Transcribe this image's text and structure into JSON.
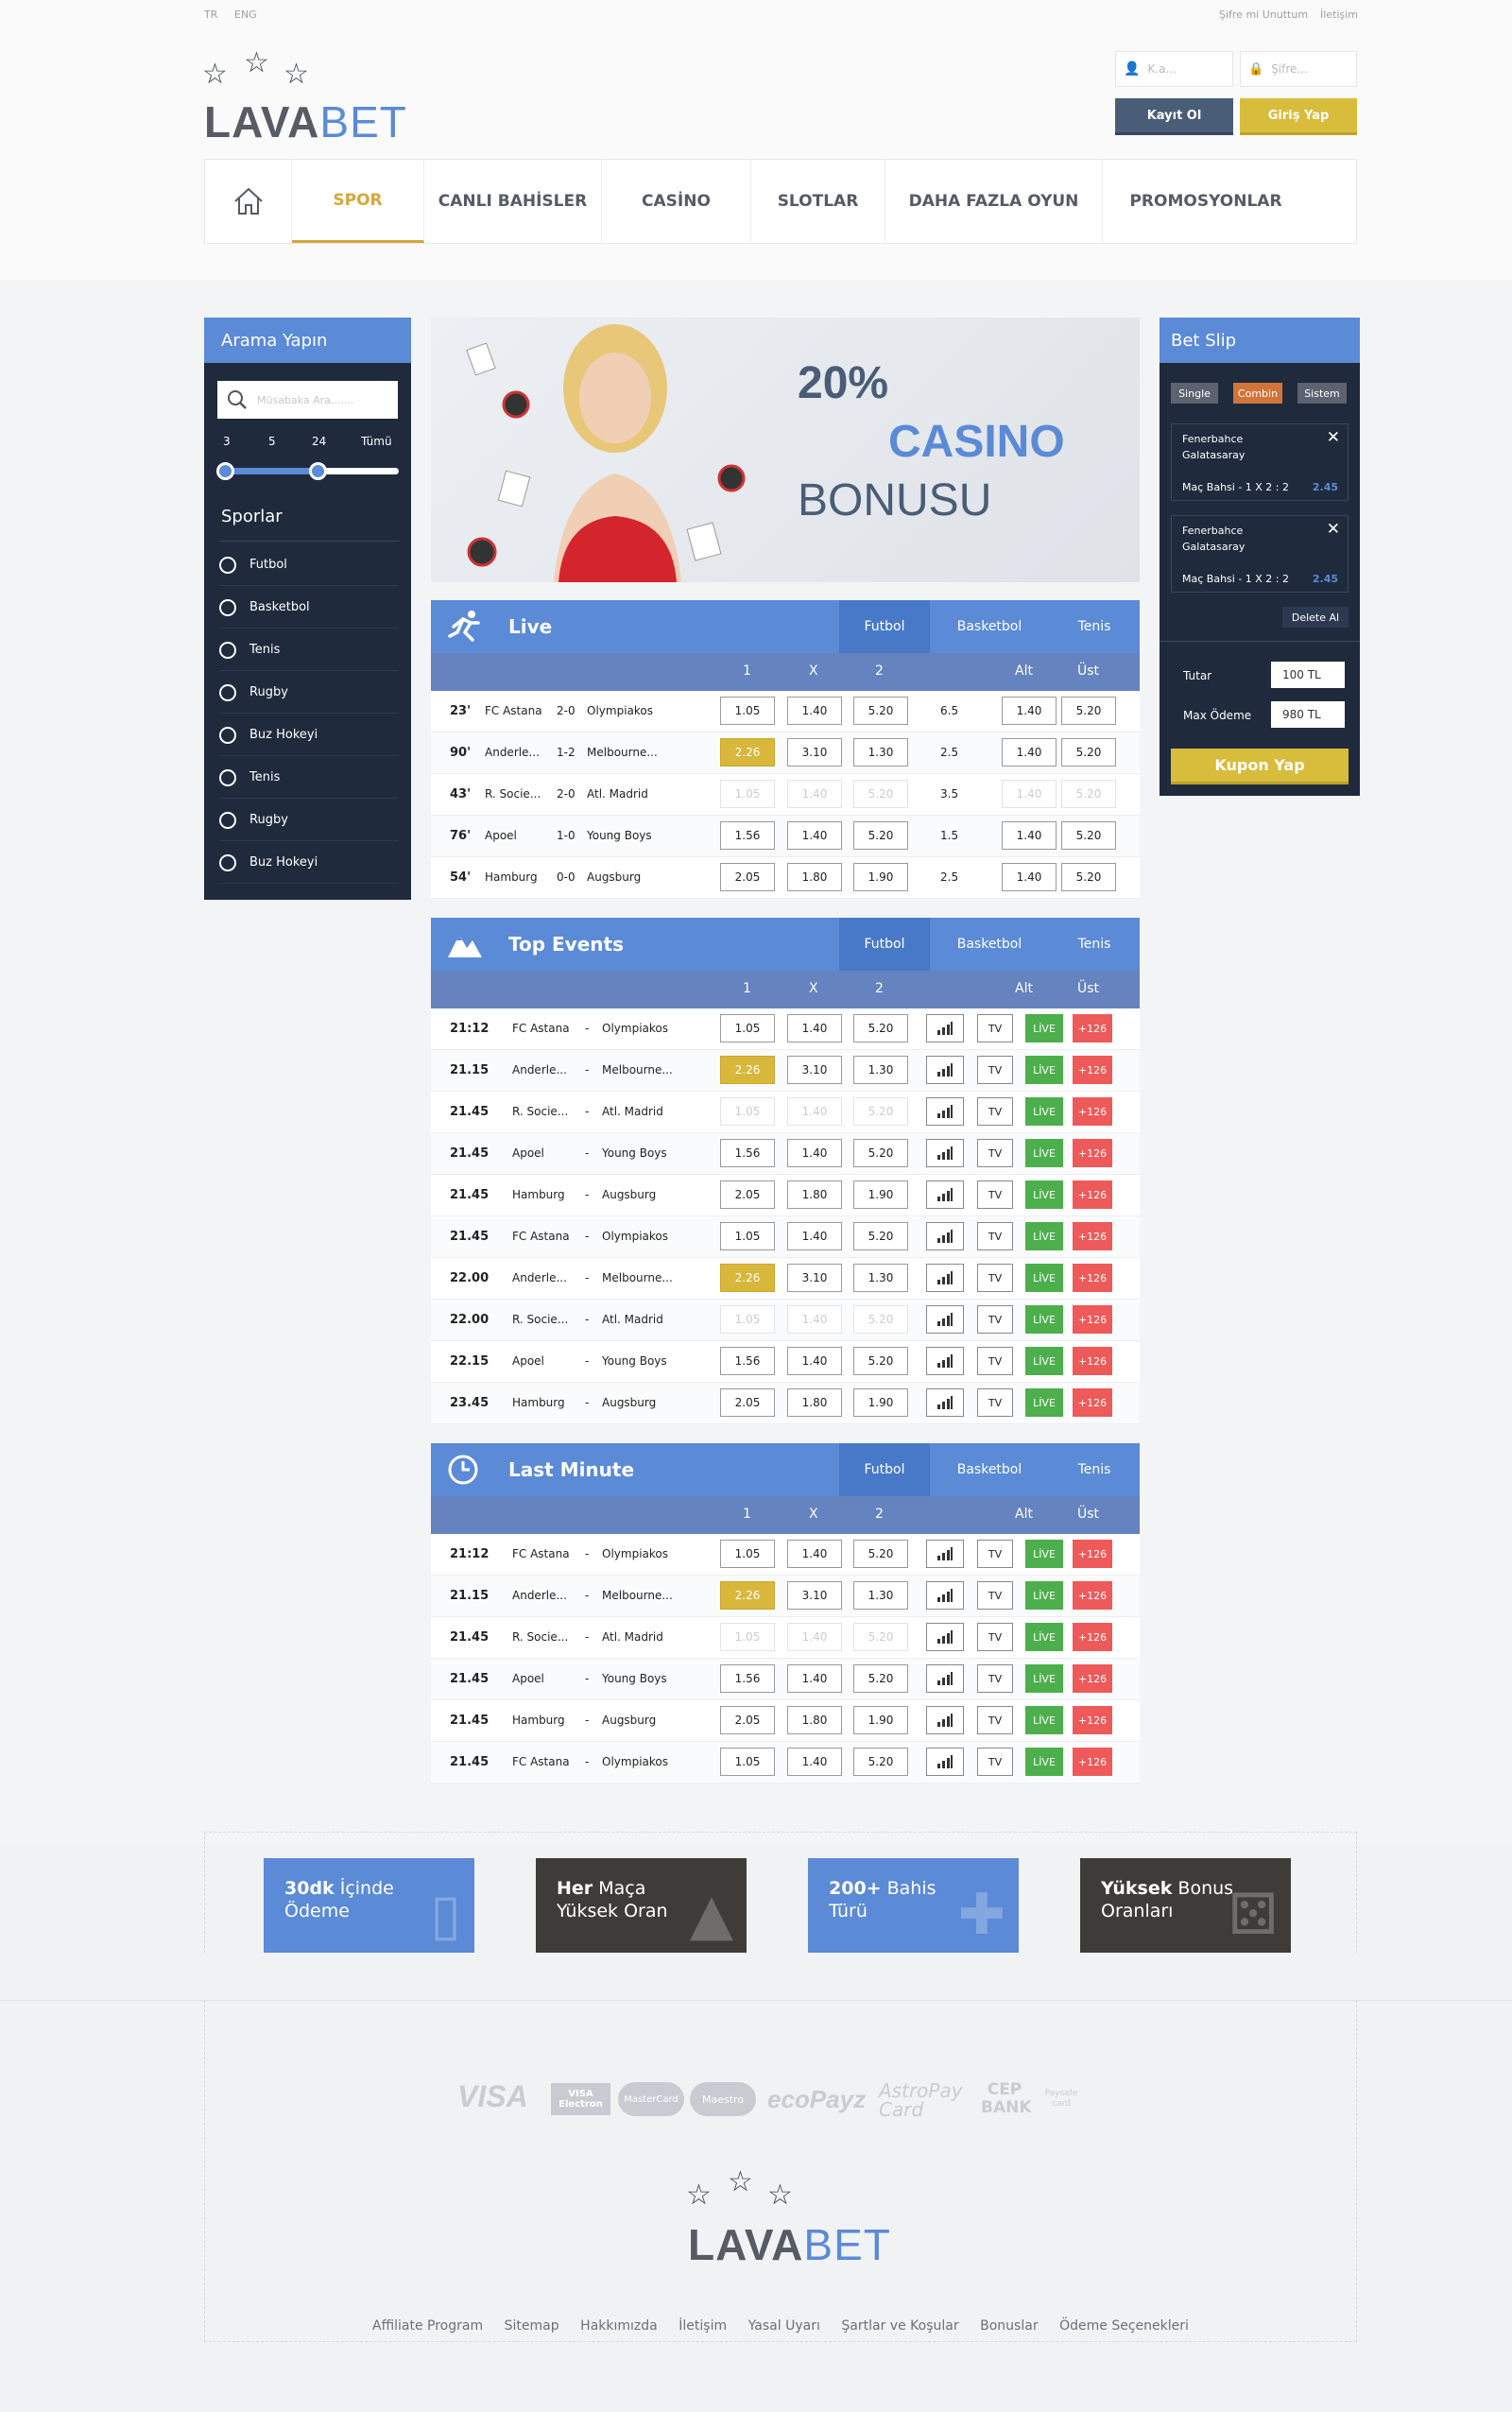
{
  "top": {
    "lang_tr": "TR",
    "lang_eng": "ENG",
    "forgot": "Şifre mi Unuttum",
    "contact": "İletişim"
  },
  "logo": {
    "part1": "LAVA",
    "part2": "BET"
  },
  "login": {
    "user_placeholder": "K.a...",
    "pass_placeholder": "Şifre...",
    "register": "Kayıt Ol",
    "login": "Giriş Yap"
  },
  "nav": {
    "home_icon": "home-icon",
    "items": [
      "SPOR",
      "CANLI BAHİSLER",
      "CASİNO",
      "SLOTLAR",
      "DAHA FAZLA OYUN",
      "PROMOSYONLAR"
    ]
  },
  "sidebar": {
    "title": "Arama Yapın",
    "search_placeholder": "Müsabaka Ara.......",
    "range_labels": [
      "3",
      "5",
      "24",
      "Tümü"
    ],
    "sports_title": "Sporlar",
    "sports": [
      "Futbol",
      "Basketbol",
      "Tenis",
      "Rugby",
      "Buz Hokeyi",
      "Tenis",
      "Rugby",
      "Buz Hokeyi"
    ]
  },
  "banner": {
    "line1": "20%",
    "line2": "CASINO",
    "line3": "BONUSU"
  },
  "live": {
    "title": "Live",
    "tabs": [
      "Futbol",
      "Basketbol",
      "Tenis"
    ],
    "cols": [
      "1",
      "X",
      "2",
      "Alt",
      "Üst"
    ],
    "rows": [
      {
        "min": "23'",
        "home": "FC Astana",
        "score": "2-0",
        "away": "Olympiakos",
        "o1": "1.05",
        "ox": "1.40",
        "o2": "5.20",
        "line": "6.5",
        "alt": "1.40",
        "ust": "5.20"
      },
      {
        "min": "90'",
        "home": "Anderle...",
        "score": "1-2",
        "away": "Melbourne...",
        "o1": "2.26",
        "ox": "3.10",
        "o2": "1.30",
        "line": "2.5",
        "alt": "1.40",
        "ust": "5.20"
      },
      {
        "min": "43'",
        "home": "R. Socie...",
        "score": "2-0",
        "away": "Atl. Madrid",
        "o1": "1.05",
        "ox": "1.40",
        "o2": "5.20",
        "line": "3.5",
        "alt": "1.40",
        "ust": "5.20"
      },
      {
        "min": "76'",
        "home": "Apoel",
        "score": "1-0",
        "away": "Young Boys",
        "o1": "1.56",
        "ox": "1.40",
        "o2": "5.20",
        "line": "1.5",
        "alt": "1.40",
        "ust": "5.20"
      },
      {
        "min": "54'",
        "home": "Hamburg",
        "score": "0-0",
        "away": "Augsburg",
        "o1": "2.05",
        "ox": "1.80",
        "o2": "1.90",
        "line": "2.5",
        "alt": "1.40",
        "ust": "5.20"
      }
    ]
  },
  "top_events": {
    "title": "Top Events",
    "tabs": [
      "Futbol",
      "Basketbol",
      "Tenis"
    ],
    "cols": [
      "1",
      "X",
      "2",
      "Alt",
      "Üst"
    ],
    "tv": "TV",
    "live": "LİVE",
    "more": "+126",
    "rows": [
      {
        "time": "21:12",
        "home": "FC Astana",
        "sep": "-",
        "away": "Olympiakos",
        "o1": "1.05",
        "ox": "1.40",
        "o2": "5.20"
      },
      {
        "time": "21.15",
        "home": "Anderle...",
        "sep": "-",
        "away": "Melbourne...",
        "o1": "2.26",
        "ox": "3.10",
        "o2": "1.30"
      },
      {
        "time": "21.45",
        "home": "R. Socie...",
        "sep": "-",
        "away": "Atl. Madrid",
        "o1": "1.05",
        "ox": "1.40",
        "o2": "5.20"
      },
      {
        "time": "21.45",
        "home": "Apoel",
        "sep": "-",
        "away": "Young Boys",
        "o1": "1.56",
        "ox": "1.40",
        "o2": "5.20"
      },
      {
        "time": "21.45",
        "home": "Hamburg",
        "sep": "-",
        "away": "Augsburg",
        "o1": "2.05",
        "ox": "1.80",
        "o2": "1.90"
      },
      {
        "time": "21.45",
        "home": "FC Astana",
        "sep": "-",
        "away": "Olympiakos",
        "o1": "1.05",
        "ox": "1.40",
        "o2": "5.20"
      },
      {
        "time": "22.00",
        "home": "Anderle...",
        "sep": "-",
        "away": "Melbourne...",
        "o1": "2.26",
        "ox": "3.10",
        "o2": "1.30"
      },
      {
        "time": "22.00",
        "home": "R. Socie...",
        "sep": "-",
        "away": "Atl. Madrid",
        "o1": "1.05",
        "ox": "1.40",
        "o2": "5.20"
      },
      {
        "time": "22.15",
        "home": "Apoel",
        "sep": "-",
        "away": "Young Boys",
        "o1": "1.56",
        "ox": "1.40",
        "o2": "5.20"
      },
      {
        "time": "23.45",
        "home": "Hamburg",
        "sep": "-",
        "away": "Augsburg",
        "o1": "2.05",
        "ox": "1.80",
        "o2": "1.90"
      }
    ]
  },
  "last_minute": {
    "title": "Last Minute",
    "tabs": [
      "Futbol",
      "Basketbol",
      "Tenis"
    ],
    "cols": [
      "1",
      "X",
      "2",
      "Alt",
      "Üst"
    ],
    "tv": "TV",
    "live": "LİVE",
    "more": "+126",
    "rows": [
      {
        "time": "21:12",
        "home": "FC Astana",
        "sep": "-",
        "away": "Olympiakos",
        "o1": "1.05",
        "ox": "1.40",
        "o2": "5.20"
      },
      {
        "time": "21.15",
        "home": "Anderle...",
        "sep": "-",
        "away": "Melbourne...",
        "o1": "2.26",
        "ox": "3.10",
        "o2": "1.30"
      },
      {
        "time": "21.45",
        "home": "R. Socie...",
        "sep": "-",
        "away": "Atl. Madrid",
        "o1": "1.05",
        "ox": "1.40",
        "o2": "5.20"
      },
      {
        "time": "21.45",
        "home": "Apoel",
        "sep": "-",
        "away": "Young Boys",
        "o1": "1.56",
        "ox": "1.40",
        "o2": "5.20"
      },
      {
        "time": "21.45",
        "home": "Hamburg",
        "sep": "-",
        "away": "Augsburg",
        "o1": "2.05",
        "ox": "1.80",
        "o2": "1.90"
      },
      {
        "time": "21.45",
        "home": "FC Astana",
        "sep": "-",
        "away": "Olympiakos",
        "o1": "1.05",
        "ox": "1.40",
        "o2": "5.20"
      }
    ]
  },
  "betslip": {
    "title": "Bet Slip",
    "types": [
      "Single",
      "Combin",
      "Sistem"
    ],
    "items": [
      {
        "home": "Fenerbahce",
        "away": "Galatasaray",
        "market": "Maç Bahsi - 1 X 2 : 2",
        "odd": "2.45"
      },
      {
        "home": "Fenerbahce",
        "away": "Galatasaray",
        "market": "Maç Bahsi - 1 X 2 : 2",
        "odd": "2.45"
      }
    ],
    "delete_all": "Delete Al",
    "amount_label": "Tutar",
    "amount_value": "100 TL",
    "max_label": "Max Ödeme",
    "max_value": "980 TL",
    "submit": "Kupon Yap"
  },
  "features": [
    {
      "bold": "30dk",
      "rest": " İçinde",
      "line2": "Ödeme",
      "color": "#5b8ad6"
    },
    {
      "bold": "Her",
      "rest": " Maça",
      "line2": "Yüksek Oran",
      "color": "#3e3c39"
    },
    {
      "bold": "200+",
      "rest": " Bahis",
      "line2": "Türü",
      "color": "#5b8ad6"
    },
    {
      "bold": "Yüksek",
      "rest": " Bonus",
      "line2": "Oranları",
      "color": "#3e3c39"
    }
  ],
  "payments": [
    "VISA",
    "VISA Electron",
    "MasterCard",
    "Maestro",
    "ecoPayz",
    "AstroPay Card",
    "CEP BANK",
    "Paysafe card"
  ],
  "footer_links": [
    "Affiliate Program",
    "Sitemap",
    "Hakkımızda",
    "İletişim",
    "Yasal Uyarı",
    "Şartlar ve Koşular",
    "Bonuslar",
    "Ödeme Seçenekleri"
  ],
  "colors": {
    "primary": "#5b8ad6",
    "dark": "#1f2a3d",
    "gold": "#d8bc3c",
    "live": "#4caf4c",
    "more": "#ee5a5a"
  }
}
